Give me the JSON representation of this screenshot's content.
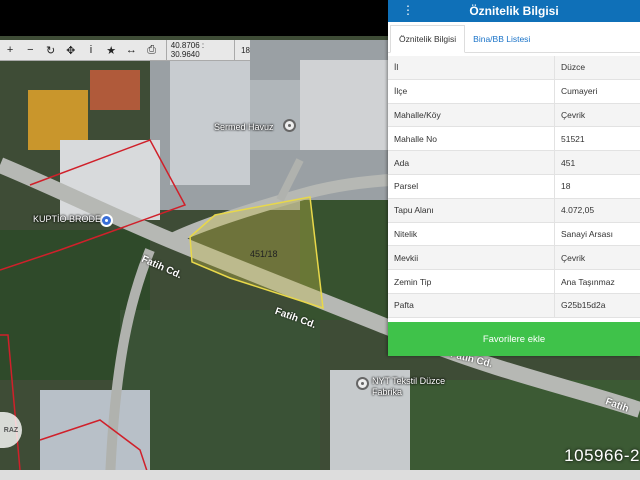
{
  "toolbar": {
    "coords": "40.8706 : 30.9640",
    "zoom": "18",
    "tools": [
      "plus-icon",
      "minus-icon",
      "refresh-icon",
      "target-icon",
      "info-icon",
      "star-icon",
      "measure-icon",
      "print-icon"
    ]
  },
  "map": {
    "labels": {
      "sermed": "Sermed Havuz",
      "kuptio": "KUPTİO BRODE",
      "nyt": "NYT Tekstil Düzce",
      "nyt2": "Fabrika",
      "parcel": "451/18"
    },
    "roads": {
      "fatih1": "Fatih Cd.",
      "fatih2": "Fatih Cd.",
      "fatih3": "Fatih Cd.",
      "fatih4": "Fatih"
    },
    "listing_id": "105966-2",
    "logo_text": "RAZ"
  },
  "panel": {
    "title": "Öznitelik Bilgisi",
    "tabs": [
      "Öznitelik Bilgisi",
      "Bina/BB Listesi"
    ],
    "rows": [
      {
        "k": "İl",
        "v": "Düzce"
      },
      {
        "k": "İlçe",
        "v": "Cumayeri"
      },
      {
        "k": "Mahalle/Köy",
        "v": "Çevrik"
      },
      {
        "k": "Mahalle No",
        "v": "51521"
      },
      {
        "k": "Ada",
        "v": "451"
      },
      {
        "k": "Parsel",
        "v": "18"
      },
      {
        "k": "Tapu Alanı",
        "v": "4.072,05"
      },
      {
        "k": "Nitelik",
        "v": "Sanayi Arsası"
      },
      {
        "k": "Mevkii",
        "v": "Çevrik"
      },
      {
        "k": "Zemin Tip",
        "v": "Ana Taşınmaz"
      },
      {
        "k": "Pafta",
        "v": "G25b15d2a"
      }
    ],
    "fav_button": "Favorilere ekle"
  },
  "colors": {
    "header": "#0f70b8",
    "fav": "#3fc24a",
    "parcel_border": "#e8d84a",
    "boundary": "#d0202a"
  }
}
